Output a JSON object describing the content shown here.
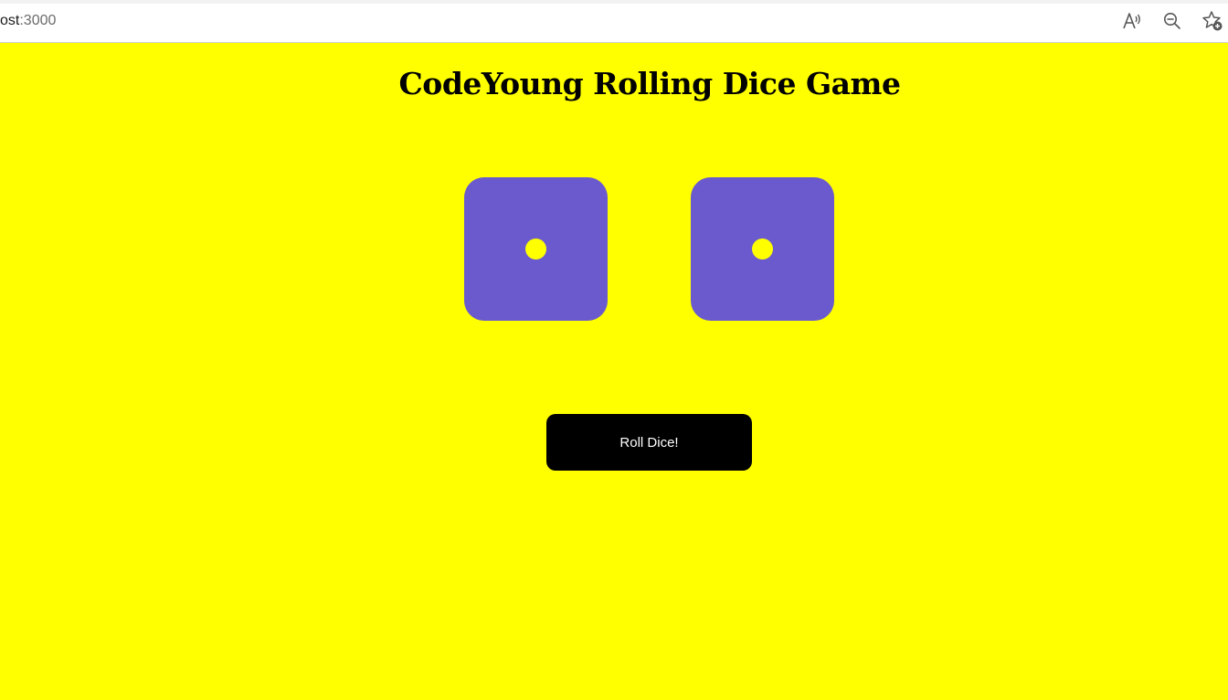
{
  "browser": {
    "address_host_tail": "ost",
    "address_port": ":3000",
    "icons": [
      "read-aloud-icon",
      "zoom-out-icon",
      "add-favorite-icon"
    ]
  },
  "page": {
    "title": "CodeYoung Rolling Dice Game",
    "background_color": "#ffff00",
    "dice": [
      {
        "value": 1,
        "color": "#6a5acd",
        "pip_color": "#ffff00"
      },
      {
        "value": 1,
        "color": "#6a5acd",
        "pip_color": "#ffff00"
      }
    ],
    "roll_button_label": "Roll Dice!"
  }
}
